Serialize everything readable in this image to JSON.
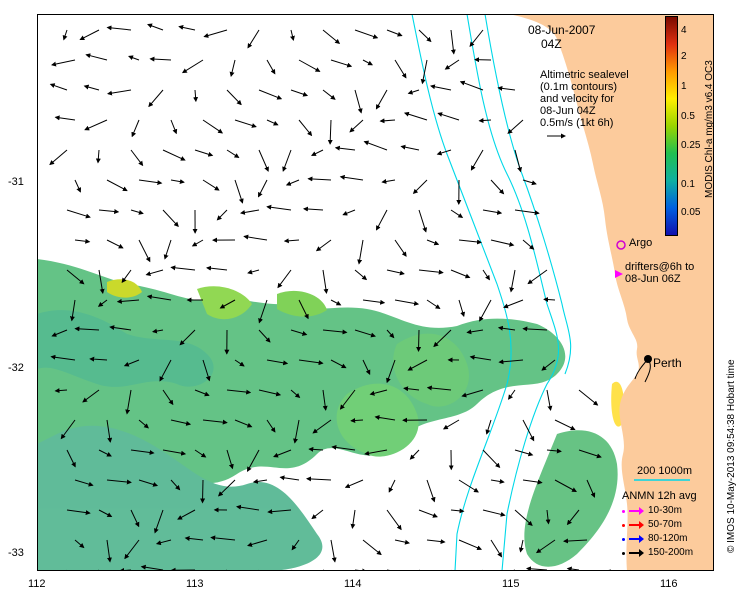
{
  "map": {
    "date": "08-Jun-2007",
    "time": "04Z",
    "description_lines": [
      "Altimetric sealevel",
      "(0.1m contours)",
      "and velocity for",
      "08-Jun 04Z",
      "0.5m/s (1kt 6h)"
    ],
    "place_label": "Perth",
    "argo_label": "Argo",
    "drifters_lines": [
      "drifters@6h to",
      "08-Jun 06Z"
    ],
    "isobath_label": "200  1000m",
    "anmn_title": "ANMN 12h avg",
    "anmn_items": [
      {
        "label": "10-30m",
        "color": "#ff00ff"
      },
      {
        "label": "50-70m",
        "color": "#ff0000"
      },
      {
        "label": "80-120m",
        "color": "#0000ff"
      },
      {
        "label": "150-200m",
        "color": "#000000"
      }
    ],
    "lon_ticks": [
      "112",
      "113",
      "114",
      "115",
      "116"
    ],
    "lat_ticks": [
      "-31",
      "-32",
      "-33"
    ],
    "colors": {
      "land": "#fccb9c",
      "isobath": "#00d8e8",
      "argo": "#d000d0"
    }
  },
  "colorbar": {
    "label": "MODIS Chl-a mg/m3 v6.4 OC3",
    "ticks": [
      "4",
      "2",
      "1",
      "0.5",
      "0.25",
      "0.1",
      "0.05"
    ],
    "stops": [
      "#7a0a00",
      "#e03010",
      "#ff9a00",
      "#ffee00",
      "#9ad400",
      "#22c050",
      "#10b0a0",
      "#0060e0",
      "#1010b0"
    ]
  },
  "credit": "© IMOS 10-May-2013 09:54:38 Hobart time"
}
